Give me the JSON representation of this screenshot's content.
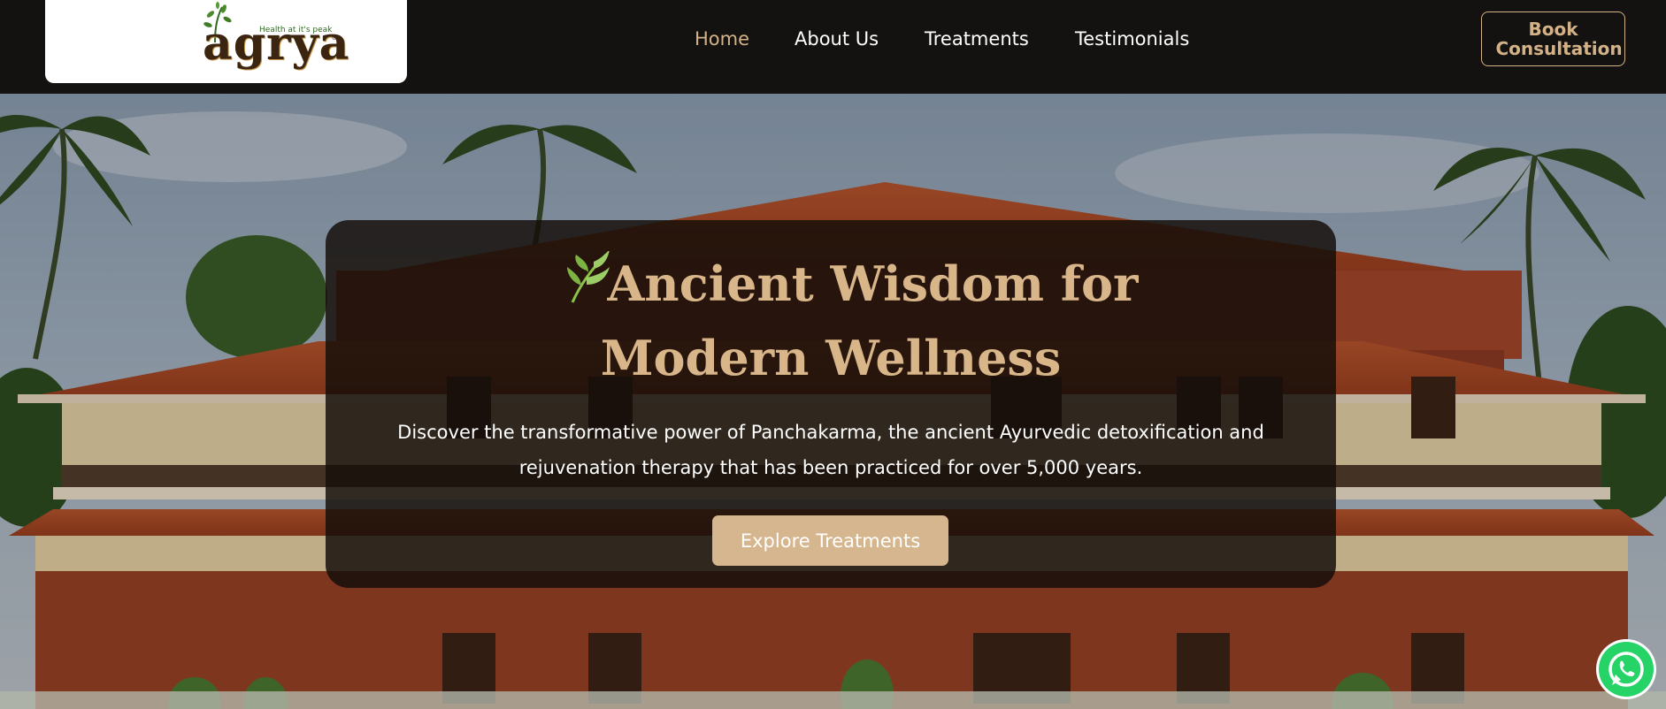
{
  "brand": {
    "logo_word": "agrya",
    "tagline": "Health at it's peak",
    "registered": "®"
  },
  "nav": {
    "items": [
      {
        "label": "Home",
        "active": true
      },
      {
        "label": "About Us",
        "active": false
      },
      {
        "label": "Treatments",
        "active": false
      },
      {
        "label": "Testimonials",
        "active": false
      }
    ]
  },
  "header": {
    "book_button": "Book Consultation"
  },
  "hero": {
    "icon": "leaf-icon",
    "title_line1": "Ancient Wisdom for",
    "title_line2": "Modern Wellness",
    "subtitle": "Discover the transformative power of Panchakarma, the ancient Ayurvedic detoxification and rejuvenation therapy that has been practiced for over 5,000 years.",
    "cta_label": "Explore Treatments"
  },
  "floating": {
    "whatsapp_icon": "whatsapp-icon"
  },
  "colors": {
    "accent": "#d4b287",
    "header_bg": "#141210",
    "card_bg": "#140e0a",
    "whatsapp": "#25d366"
  }
}
